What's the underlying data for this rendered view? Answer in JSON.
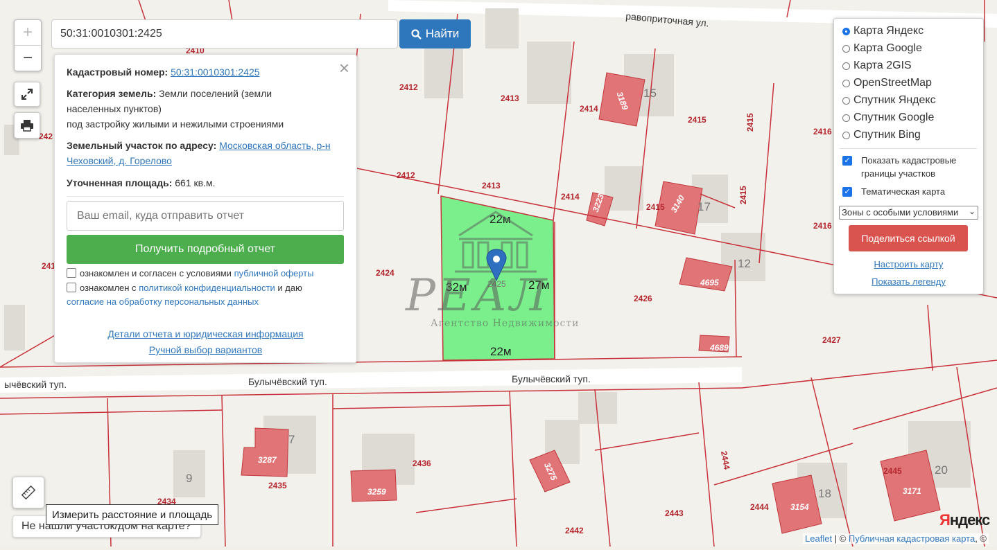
{
  "search": {
    "value": "50:31:0010301:2425",
    "button": "Найти"
  },
  "zoom": {
    "in": "+",
    "out": "−"
  },
  "info": {
    "cadastral_label": "Кадастровый номер:",
    "cadastral_value": "50:31:0010301:2425",
    "category_label": "Категория земель:",
    "category_value": "Земли поселений (земли населенных пунктов)",
    "category_use": "под застройку жилыми и нежилыми строениями",
    "address_label": "Земельный участок по адресу:",
    "address_value": "Московская область, р-н Чеховский, д. Горелово",
    "area_label": "Уточненная площадь:",
    "area_value": "661 кв.м.",
    "email_placeholder": "Ваш email, куда отправить отчет",
    "report_button": "Получить подробный отчет",
    "consent1_pre": "ознакомлен и согласен с условиями ",
    "consent1_link": "публичной оферты",
    "consent2_pre": "ознакомлен с ",
    "consent2_link1": "политикой конфиденциальности",
    "consent2_mid": " и даю",
    "consent2_link2": "согласие на обработку персональных данных",
    "details_link": "Детали отчета и юридическая информация",
    "manual_link": "Ручной выбор вариантов",
    "close": "×"
  },
  "layers": {
    "base": [
      "Карта Яндекс",
      "Карта Google",
      "Карта 2GIS",
      "OpenStreetMap",
      "Спутник Яндекс",
      "Спутник Google",
      "Спутник Bing"
    ],
    "selected": "Карта Яндекс",
    "overlay1": "Показать кадастровые границы участков",
    "overlay2": "Тематическая карта",
    "zone_select": "Зоны с особыми условиями",
    "share": "Поделиться ссылкой",
    "configure": "Настроить карту",
    "legend": "Показать легенду"
  },
  "tools": {
    "measure_tooltip": "Измерить расстояние и площадь",
    "not_found": "Не нашли участок/дом на карте?"
  },
  "attribution": {
    "leaflet": "Leaflet",
    "sep": " | © ",
    "pkk": "Публичная кадастровая карта",
    "tail": ", ©",
    "yandex_y": "Я",
    "yandex_rest": "ндекс"
  },
  "watermark": {
    "logo": "РЕАЛ",
    "text": "Агентство Недвижимости"
  },
  "map": {
    "streets": [
      "равоприточная ул.",
      "Булычёвский туп.",
      "Булычёвский туп.",
      "ычёвский туп."
    ],
    "selected_parcel": "2425",
    "dimensions": {
      "top": "22м",
      "bottom": "22м",
      "left": "32м",
      "right": "27м"
    },
    "parcels": [
      "2410",
      "2412",
      "2413",
      "2414",
      "2415",
      "2415",
      "2416",
      "2412",
      "2413",
      "2414",
      "2415",
      "2415",
      "2416",
      "2424",
      "2426",
      "2427",
      "2435",
      "2436",
      "2434",
      "2443",
      "2442",
      "2444",
      "2444",
      "2445",
      "242",
      "241"
    ],
    "buildings": [
      "3189",
      "3223",
      "3140",
      "4695",
      "4689",
      "3287",
      "3259",
      "3275",
      "3154",
      "3171"
    ],
    "house_numbers": [
      "15",
      "17",
      "12",
      "7",
      "9",
      "18",
      "20"
    ]
  }
}
